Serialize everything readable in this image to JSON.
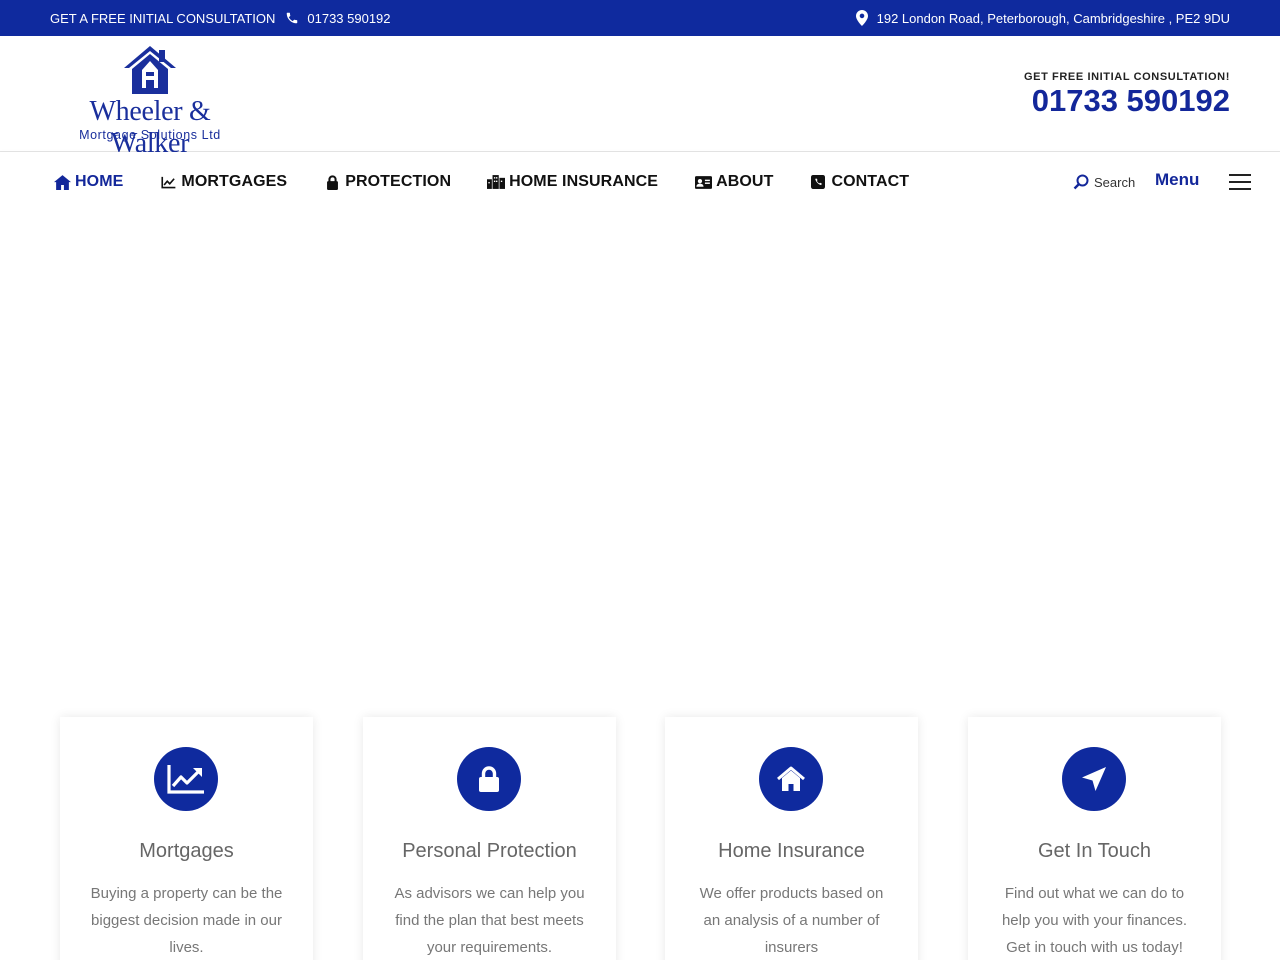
{
  "topbar": {
    "consultation": "GET A FREE INITIAL CONSULTATION",
    "phone": "01733 590192",
    "address": "192 London Road, Peterborough, Cambridgeshire , PE2 9DU"
  },
  "header": {
    "logo_name": "Wheeler & Walker",
    "logo_sub": "Mortgage Solutions Ltd",
    "cta_label": "GET FREE INITIAL CONSULTATION!",
    "cta_phone": "01733 590192"
  },
  "nav": {
    "items": [
      {
        "label": "HOME",
        "icon": "home-icon"
      },
      {
        "label": "MORTGAGES",
        "icon": "chart-line-icon"
      },
      {
        "label": "PROTECTION",
        "icon": "lock-icon"
      },
      {
        "label": "HOME INSURANCE",
        "icon": "buildings-icon"
      },
      {
        "label": "ABOUT",
        "icon": "id-card-icon"
      },
      {
        "label": "CONTACT",
        "icon": "phone-square-icon"
      }
    ],
    "search_label": "Search",
    "menu_label": "Menu"
  },
  "cards": [
    {
      "title": "Mortgages",
      "text": "Buying a property can be the biggest decision made in our lives.",
      "icon": "chart-line-icon"
    },
    {
      "title": "Personal Protection",
      "text": "As advisors we can help you find the plan that best meets your requirements.",
      "icon": "lock-icon"
    },
    {
      "title": "Home Insurance",
      "text": "We offer products based on an analysis of a number of insurers",
      "icon": "home-icon"
    },
    {
      "title": "Get In Touch",
      "text": "Find out what we can do to help you with your finances. Get in touch with us today!",
      "icon": "location-arrow-icon"
    }
  ],
  "colors": {
    "brand": "#0f2a9e",
    "brand_text": "#13279a"
  }
}
